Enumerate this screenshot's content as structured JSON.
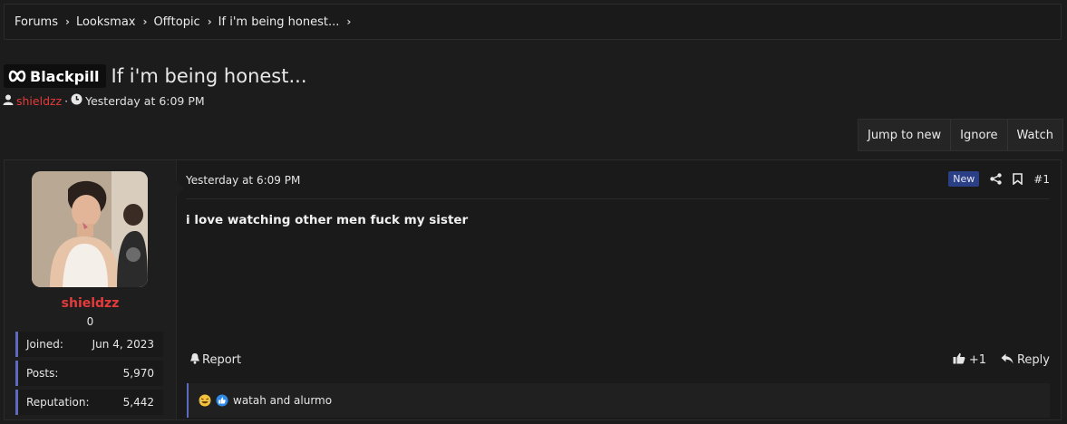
{
  "breadcrumb": {
    "items": [
      {
        "label": "Forums"
      },
      {
        "label": "Looksmax"
      },
      {
        "label": "Offtopic"
      },
      {
        "label": "If i'm being honest..."
      }
    ],
    "separator": "›"
  },
  "thread": {
    "prefix": "Blackpill",
    "title": "If i'm being honest...",
    "author": "shieldzz",
    "meta_sep": "·",
    "date": "Yesterday at 6:09 PM"
  },
  "actions": [
    "Jump to new",
    "Ignore",
    "Watch"
  ],
  "post": {
    "user": {
      "name": "shieldzz",
      "title": "0",
      "stats": [
        {
          "label": "Joined:",
          "value": "Jun 4, 2023"
        },
        {
          "label": "Posts:",
          "value": "5,970"
        },
        {
          "label": "Reputation:",
          "value": "5,442"
        }
      ]
    },
    "date": "Yesterday at 6:09 PM",
    "badge": "New",
    "number": "#1",
    "message": "i love watching other men fuck my sister",
    "report_label": "Report",
    "like_count": "+1",
    "reply_label": "Reply",
    "reactions_text": "watah and alurmo"
  },
  "colors": {
    "background": "#1c1c1c",
    "author_red": "#e53b3b",
    "accent_blue": "#5c6bc0",
    "badge_blue": "#2b3f86"
  },
  "icons": {
    "prefix": "infinity-logo-icon",
    "author": "user-icon",
    "date": "clock-icon",
    "share": "share-icon",
    "bookmark": "bookmark-icon",
    "report": "bell-icon",
    "like": "thumbs-up-icon",
    "reply": "reply-icon",
    "reaction_1": "laughing-emoji-icon",
    "reaction_2": "like-reaction-icon"
  }
}
